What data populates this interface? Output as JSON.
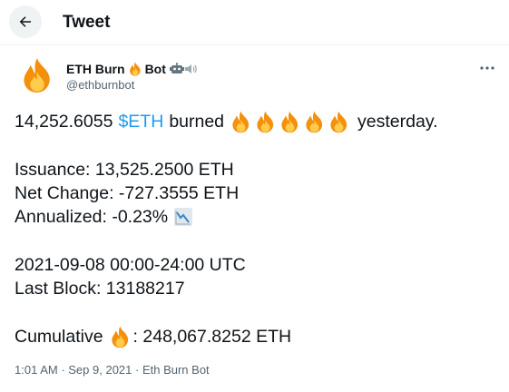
{
  "header": {
    "title": "Tweet",
    "back_icon": "arrow-left-icon"
  },
  "author": {
    "name_prefix": "ETH Burn",
    "name_suffix": "Bot",
    "handle": "@ethburnbot",
    "avatar_icon": "fire-icon",
    "badge_icons": [
      "fire-icon",
      "robot-icon",
      "speaker-icon"
    ]
  },
  "tweet": {
    "line1_number": "14,252.6055",
    "line1_cashtag": "$ETH",
    "line1_verb": "burned",
    "line1_fire_count": 5,
    "line1_tail": "yesterday.",
    "issuance": "Issuance: 13,525.2500 ETH",
    "net_change": "Net Change: -727.3555 ETH",
    "annualized": "Annualized: -0.23%",
    "annualized_icon": "chart-decreasing-icon",
    "date_range": "2021-09-08 00:00-24:00 UTC",
    "last_block": "Last Block: 13188217",
    "cumulative_label": "Cumulative",
    "cumulative_value": ": 248,067.8252 ETH"
  },
  "meta": {
    "time": "1:01 AM",
    "sep1": " · ",
    "date": "Sep 9, 2021",
    "sep2": " · ",
    "source": "Eth Burn Bot"
  },
  "colors": {
    "accent": "#1d9bf0",
    "text": "#0f1419",
    "secondary": "#536471",
    "fire_outer": "#f4900c",
    "fire_inner": "#ffcc4d"
  }
}
